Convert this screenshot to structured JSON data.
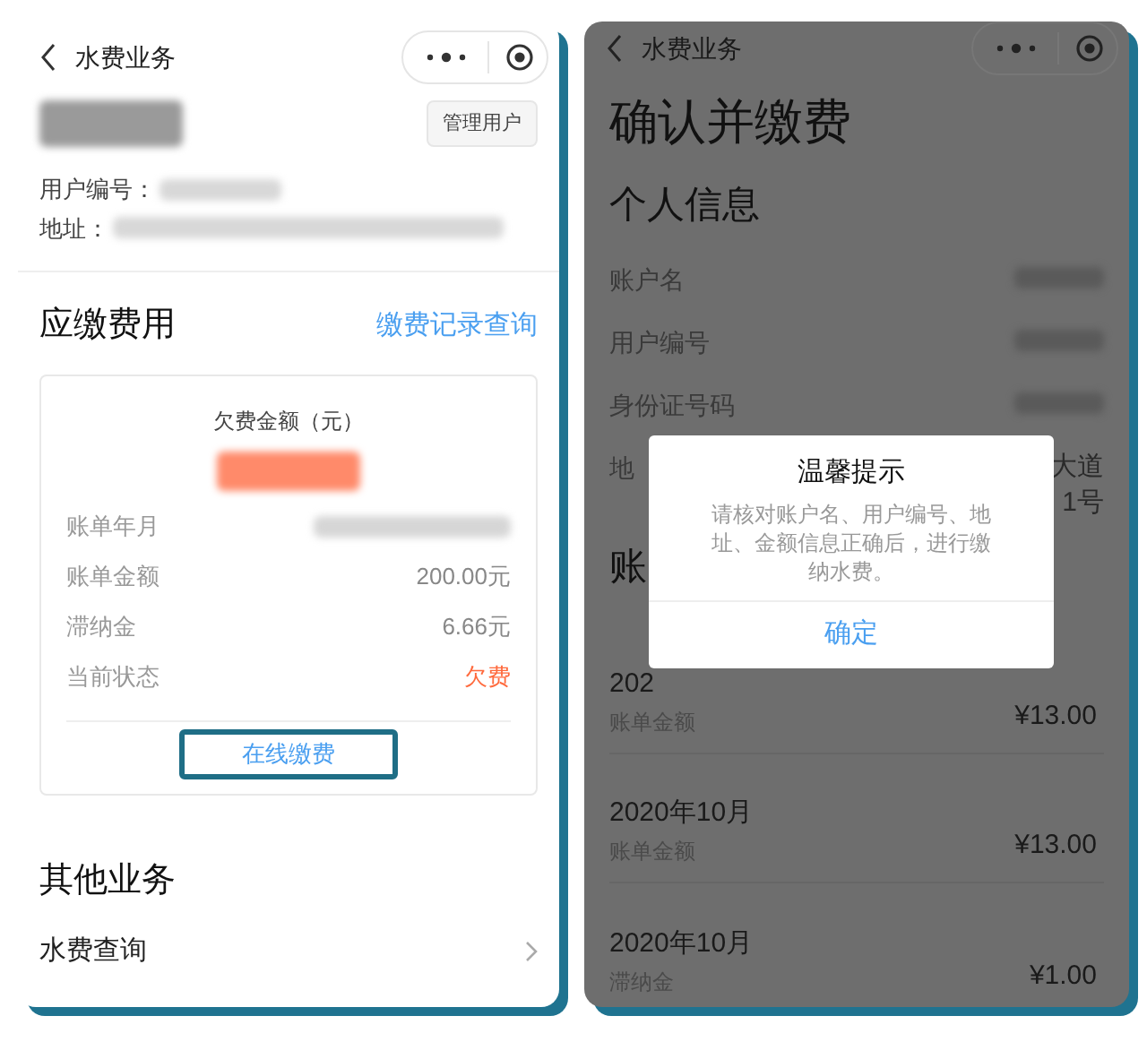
{
  "left_screen": {
    "nav_title": "水费业务",
    "manage_button": "管理用户",
    "user_fields": [
      {
        "label": "用户编号："
      },
      {
        "label": "地址："
      }
    ],
    "fees_heading": "应缴费用",
    "history_link": "缴费记录查询",
    "card": {
      "title": "欠费金额（元）",
      "rows": [
        {
          "kind": "redacted",
          "label": "账单年月"
        },
        {
          "kind": "text",
          "label": "账单金额",
          "value": "200.00元"
        },
        {
          "kind": "text",
          "label": "滞纳金",
          "value": "6.66元"
        },
        {
          "kind": "status",
          "label": "当前状态",
          "value": "欠费"
        }
      ],
      "pay_button": "在线缴费"
    },
    "other_heading": "其他业务",
    "other_items": [
      {
        "label": "水费查询"
      }
    ]
  },
  "right_screen": {
    "nav_title": "水费业务",
    "page_title": "确认并缴费",
    "info_heading": "个人信息",
    "info_rows": [
      {
        "label": "账户名"
      },
      {
        "label": "用户编号"
      },
      {
        "label": "身份证号码"
      },
      {
        "label": "地",
        "value_lines": [
          "大道",
          "1号"
        ]
      }
    ],
    "bills_heading": "账",
    "bills": [
      {
        "date": "202",
        "type": "账单金额",
        "amount": "¥13.00"
      },
      {
        "date": "2020年10月",
        "type": "账单金额",
        "amount": "¥13.00"
      },
      {
        "date": "2020年10月",
        "type": "滞纳金",
        "amount": "¥1.00"
      }
    ],
    "dialog": {
      "title": "温馨提示",
      "message": "请核对账户名、用户编号、地址、金额信息正确后，进行缴纳水费。",
      "button": "确定"
    }
  }
}
